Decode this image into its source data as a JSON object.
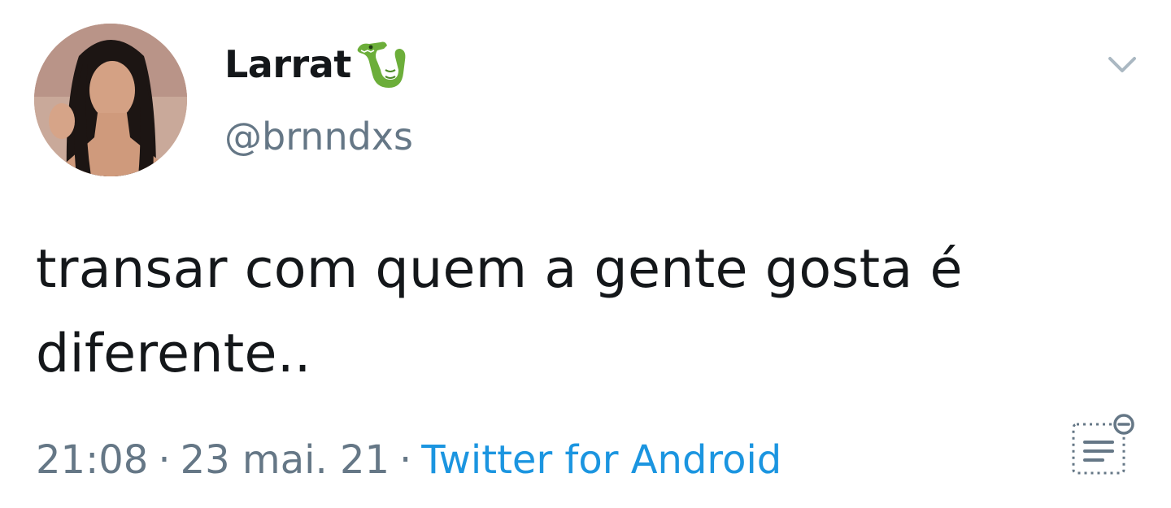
{
  "tweet": {
    "display_name": "Larrat",
    "name_emoji": "crocodile-emoji",
    "handle": "@brnndxs",
    "text": "transar com quem a gente gosta é diferente..",
    "time": "21:08",
    "separator": "·",
    "date": "23 mai. 21",
    "source": "Twitter for Android"
  },
  "icons": {
    "menu": "chevron-down-icon",
    "activity": "tweet-activity-icon"
  },
  "colors": {
    "text_primary": "#14171a",
    "text_secondary": "#657786",
    "link": "#1b95e0",
    "emoji_green": "#6cae3a"
  }
}
